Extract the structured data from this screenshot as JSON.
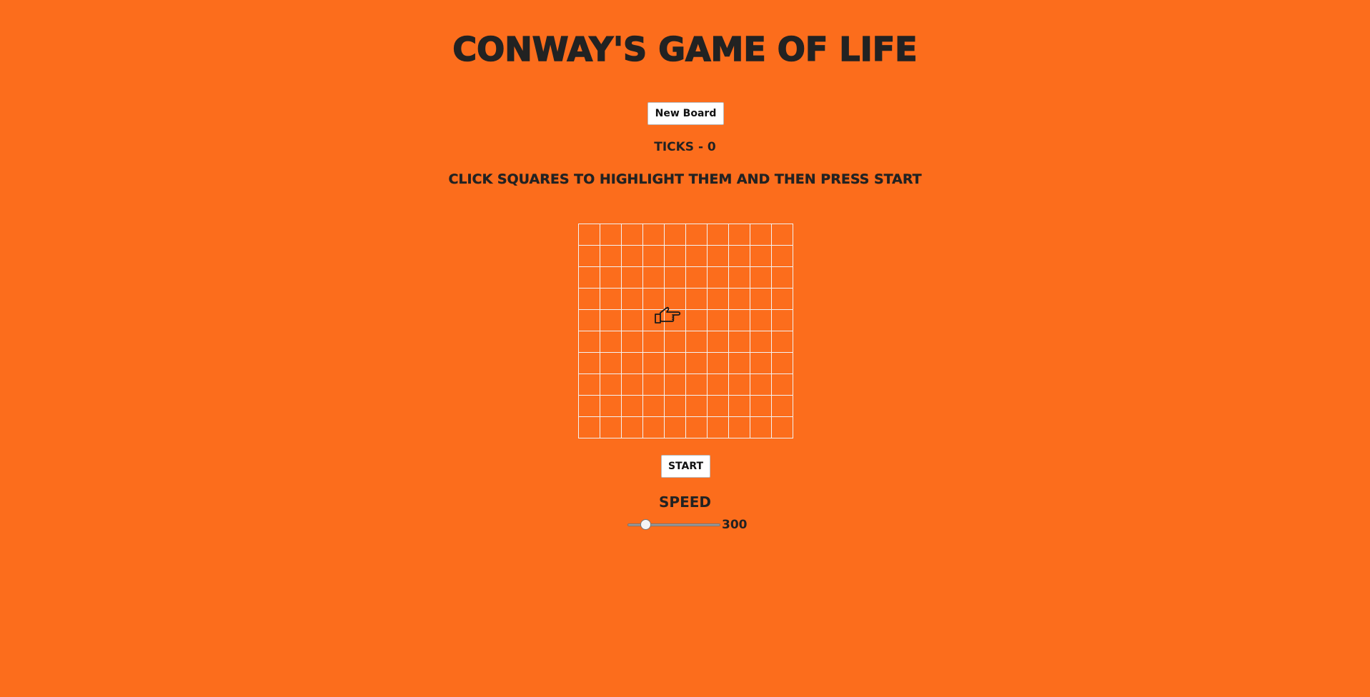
{
  "header": {
    "title": "CONWAY'S GAME OF LIFE"
  },
  "controls": {
    "new_board_label": "New Board",
    "ticks_label": "TICKS - 0",
    "instructions": "CLICK SQUARES TO HIGHLIGHT THEM AND THEN PRESS START",
    "start_label": "START"
  },
  "board": {
    "rows": 10,
    "columns": 10,
    "alive_cells": []
  },
  "speed": {
    "label": "SPEED",
    "value": "300",
    "fraction": 0.16
  },
  "icons": {
    "cursor": "pointing-hand-cursor-icon"
  },
  "colors": {
    "background": "#fc6d1c",
    "text": "#222222",
    "grid_lines": "#f3f3f3",
    "button_bg": "#ffffff"
  }
}
